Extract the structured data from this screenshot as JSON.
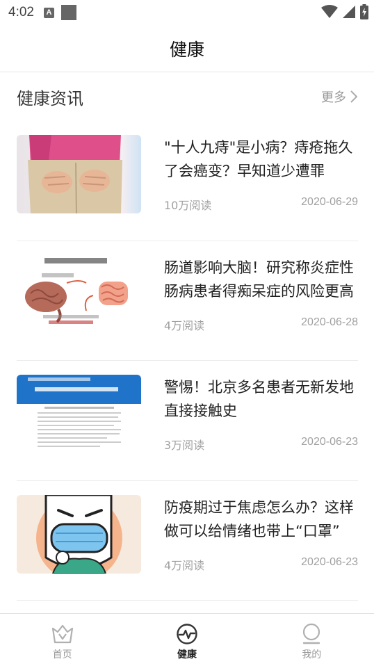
{
  "status_bar": {
    "time": "4:02",
    "a_icon_letter": "A"
  },
  "header": {
    "title": "健康"
  },
  "section": {
    "title": "健康资讯",
    "more_label": "更多"
  },
  "news": [
    {
      "title": "\"十人九痔\"是小病？痔疮拖久了会癌变？早知道少遭罪",
      "reads": "10万阅读",
      "date": "2020-06-29",
      "thumb": "back-pain-photo"
    },
    {
      "title": "肠道影响大脑！研究称炎症性肠病患者得痴呆症的风险更高",
      "reads": "4万阅读",
      "date": "2020-06-28",
      "thumb": "brain-gut-diagram"
    },
    {
      "title": "警惕！北京多名患者无新发地直接接触史",
      "reads": "3万阅读",
      "date": "2020-06-23",
      "thumb": "document-screenshot"
    },
    {
      "title": "防疫期过于焦虑怎么办？这样做可以给情绪也带上“口罩”",
      "reads": "4万阅读",
      "date": "2020-06-23",
      "thumb": "masked-cartoon"
    }
  ],
  "bottom_nav": [
    {
      "label": "首页",
      "icon": "home-crown-icon"
    },
    {
      "label": "健康",
      "icon": "pulse-icon",
      "active": true
    },
    {
      "label": "我的",
      "icon": "profile-icon"
    }
  ],
  "colors": {
    "text_primary": "#222222",
    "text_muted": "#a0a0a0",
    "icon_inactive": "#b0b0b0",
    "icon_active": "#333333"
  }
}
